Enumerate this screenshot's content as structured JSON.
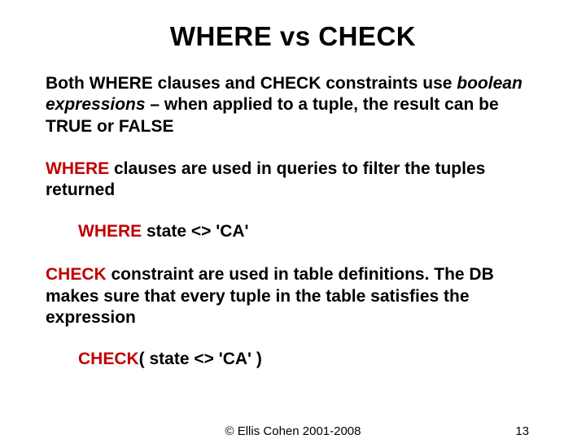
{
  "title": "WHERE vs CHECK",
  "intro": {
    "lead": "Both WHERE clauses and CHECK constraints use ",
    "boolital": "boolean expressions",
    "tail": " – when applied to a tuple, the result can be TRUE or FALSE"
  },
  "where": {
    "kw": "WHERE",
    "desc": " clauses are used in queries to filter the tuples returned",
    "code_kw": "WHERE",
    "code_rest": " state <> 'CA'"
  },
  "check": {
    "kw": "CHECK",
    "desc": " constraint are used in table definitions.  The DB makes sure that every tuple in the table satisfies the expression",
    "code_kw": "CHECK",
    "code_rest": "( state <> 'CA' )"
  },
  "footer": {
    "copyright": "© Ellis Cohen 2001-2008",
    "page": "13"
  }
}
